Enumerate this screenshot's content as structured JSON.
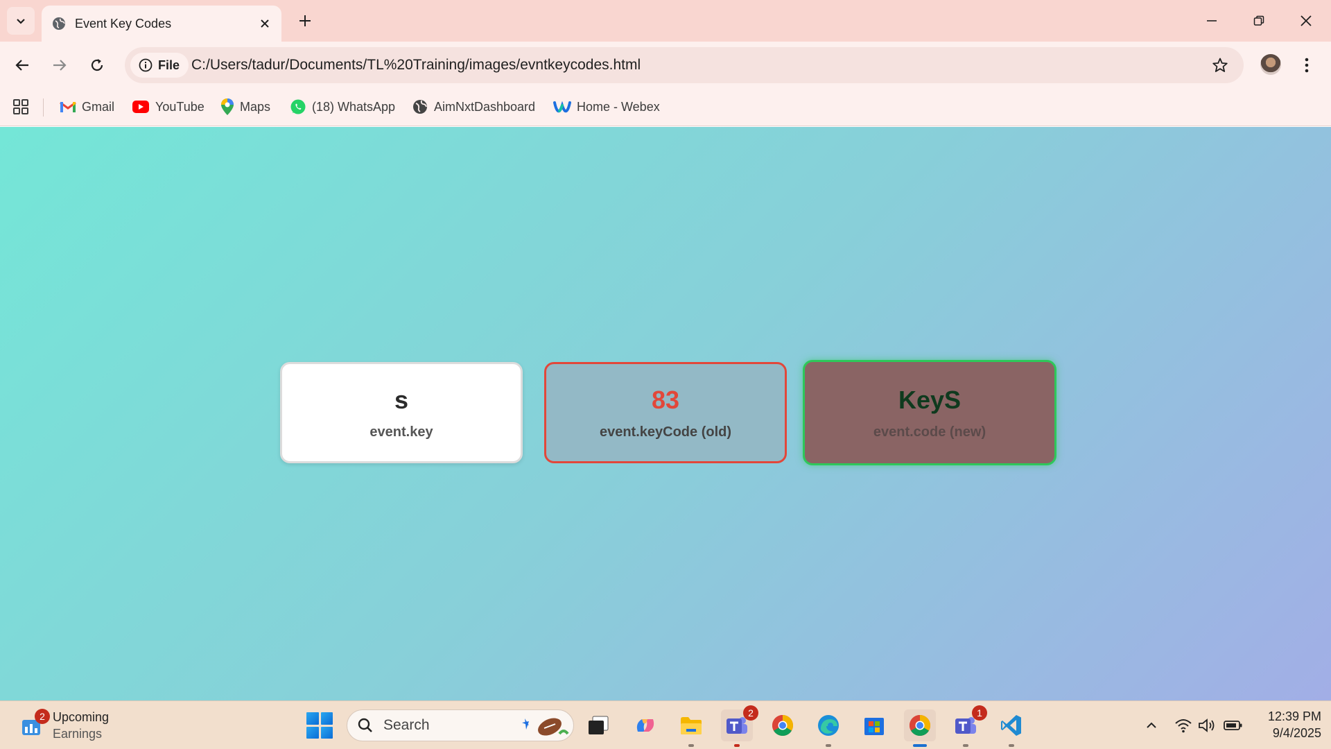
{
  "browser": {
    "tab_title": "Event Key Codes",
    "site_info_label": "File",
    "url": "C:/Users/tadur/Documents/TL%20Training/images/evntkeycodes.html"
  },
  "bookmarks": [
    {
      "label": "Gmail",
      "icon": "gmail-icon"
    },
    {
      "label": "YouTube",
      "icon": "youtube-icon"
    },
    {
      "label": "Maps",
      "icon": "maps-icon"
    },
    {
      "label": "(18) WhatsApp",
      "icon": "whatsapp-icon"
    },
    {
      "label": "AimNxtDashboard",
      "icon": "globe-icon"
    },
    {
      "label": "Home - Webex",
      "icon": "webex-icon"
    }
  ],
  "cards": [
    {
      "value": "s",
      "label": "event.key"
    },
    {
      "value": "83",
      "label": "event.keyCode (old)"
    },
    {
      "value": "KeyS",
      "label": "event.code (new)"
    }
  ],
  "taskbar": {
    "widget_title": "Upcoming",
    "widget_subtitle": "Earnings",
    "widget_badge": "2",
    "search_label": "Search",
    "teams_badge": "2",
    "teams2_badge": "1",
    "time": "12:39 PM",
    "date": "9/4/2025"
  },
  "colors": {
    "page_gradient_start": "#74e6d7",
    "page_gradient_end": "#a2aee6",
    "keycode_accent": "#e2473a",
    "code_accent": "#2ec75a"
  }
}
